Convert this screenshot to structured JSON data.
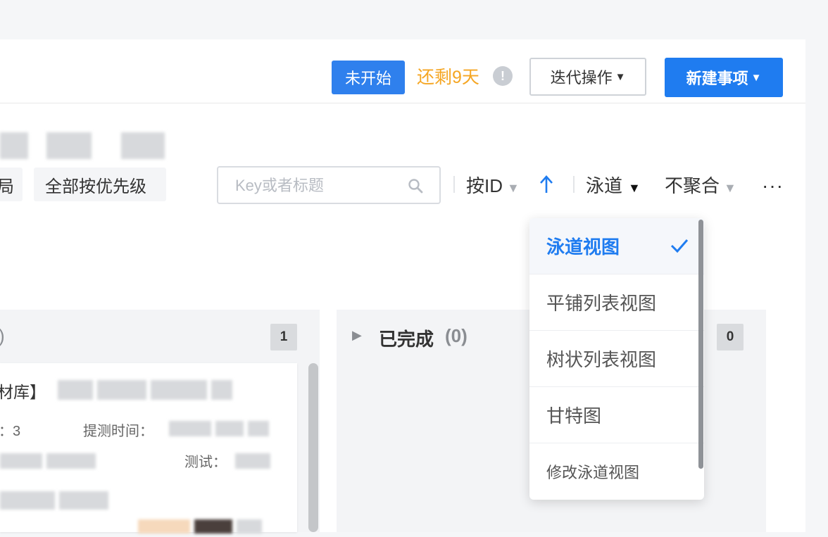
{
  "header": {
    "status_badge": "未开始",
    "remaining_text": "还剩9天",
    "info_icon_glyph": "!",
    "iteration_button": "迭代操作",
    "new_item_button": "新建事项",
    "caret_glyph": "▼"
  },
  "filters": {
    "chip_left_partial": "局",
    "chip_priority": "全部按优先级"
  },
  "search": {
    "placeholder": "Key或者标题"
  },
  "toolbar": {
    "sort_by": "按ID",
    "sort_arrow": "↑",
    "view_mode": "泳道",
    "aggregate": "不聚合",
    "more": "···"
  },
  "lanes": [
    {
      "title_partial": ")",
      "count": "1"
    },
    {
      "title": "已完成",
      "count_label": "(0)",
      "count": "0",
      "expand_glyph": "▶"
    }
  ],
  "card": {
    "title_partial": "材库】",
    "field1_partial": "：3",
    "field2_label": "提测时间：",
    "field3_label": "测试："
  },
  "view_menu": {
    "items": [
      {
        "label": "泳道视图",
        "selected": true
      },
      {
        "label": "平铺列表视图",
        "selected": false
      },
      {
        "label": "树状列表视图",
        "selected": false
      },
      {
        "label": "甘特图",
        "selected": false
      },
      {
        "label": "修改泳道视图",
        "selected": false
      }
    ]
  },
  "colors": {
    "primary": "#1f7cf0",
    "badge": "#2f80ed",
    "warning": "#f5a623"
  }
}
